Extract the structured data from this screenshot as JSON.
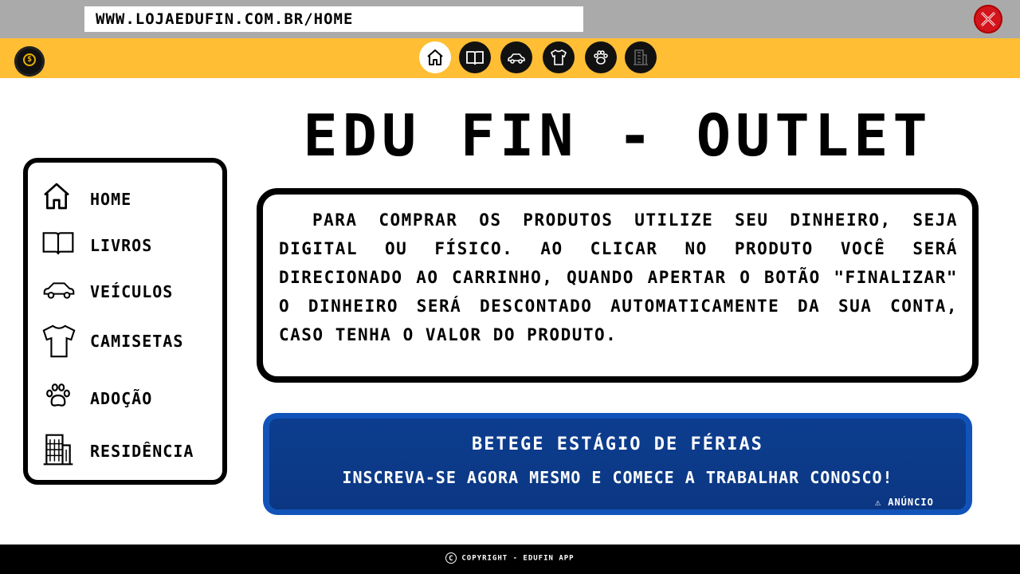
{
  "browser": {
    "url": "WWW.LOJAEDUFiN.COM.BR/HOME",
    "close_icon": "close-icon"
  },
  "topnav": {
    "logo_icon": "coin-logo-icon",
    "icons": [
      "home-icon",
      "book-icon",
      "car-icon",
      "shirt-icon",
      "paw-icon",
      "building-icon"
    ],
    "active_index": 0
  },
  "title": "EDU FiN - OUTLET",
  "sidebar": {
    "items": [
      {
        "label": "HOME",
        "icon": "home-icon"
      },
      {
        "label": "LiVROS",
        "icon": "book-icon"
      },
      {
        "label": "VEÍCULOS",
        "icon": "car-icon"
      },
      {
        "label": "CAMiSETAS",
        "icon": "shirt-icon"
      },
      {
        "label": "ADOÇÃO",
        "icon": "paw-icon"
      },
      {
        "label": "RESiDÊNCiA",
        "icon": "building-icon"
      }
    ]
  },
  "info": {
    "text": "PARA COMPRAR OS PRODUTOS UTiLiZE SEU DiNHEiRO, SEJA DiGiTAL OU FÍSiCO. AO CLiCAR NO PRODUTO VOCÊ SERÁ DiRECiONADO AO CARRiNHO, QUANDO APERTAR O BOTÃO \"FiNALiZAR\" O DiNHEiRO SERÁ DESCONTADO AUTOMATiCAMENTE DA SUA CONTA, CASO TENHA O VALOR DO PRODUTO."
  },
  "ad": {
    "title": "BETEGE ESTÁGiO DE FÉRiAS",
    "subtitle": "iNSCREVA-SE AGORA MESMO E COMECE A TRABALHAR CONOSCO!",
    "badge": "ANÚNCiO",
    "colors": {
      "outer": "#1153b8",
      "inner": "#0c3a88"
    }
  },
  "footer": {
    "text": "COPYRiGHT - EDUFiN APP"
  },
  "colors": {
    "browser_bar": "#aaaaaa",
    "nav_bar": "#ffbe33",
    "close": "#d4141c"
  }
}
